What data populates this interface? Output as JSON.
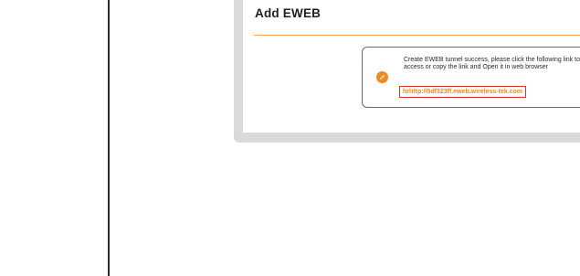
{
  "dialog": {
    "title": "Add EWEB"
  },
  "toast": {
    "icon": "compass-icon",
    "message": "Create EWEB tunnel success, please click the following link to access or copy the link and Open it in web browser",
    "link": "hrhttp://0df323ff.eweb.wireless-tek.com"
  },
  "colors": {
    "accent": "#f08a1e",
    "link_border": "#d9352b",
    "divider": "#f5a35a",
    "frame": "#d9dadc"
  }
}
